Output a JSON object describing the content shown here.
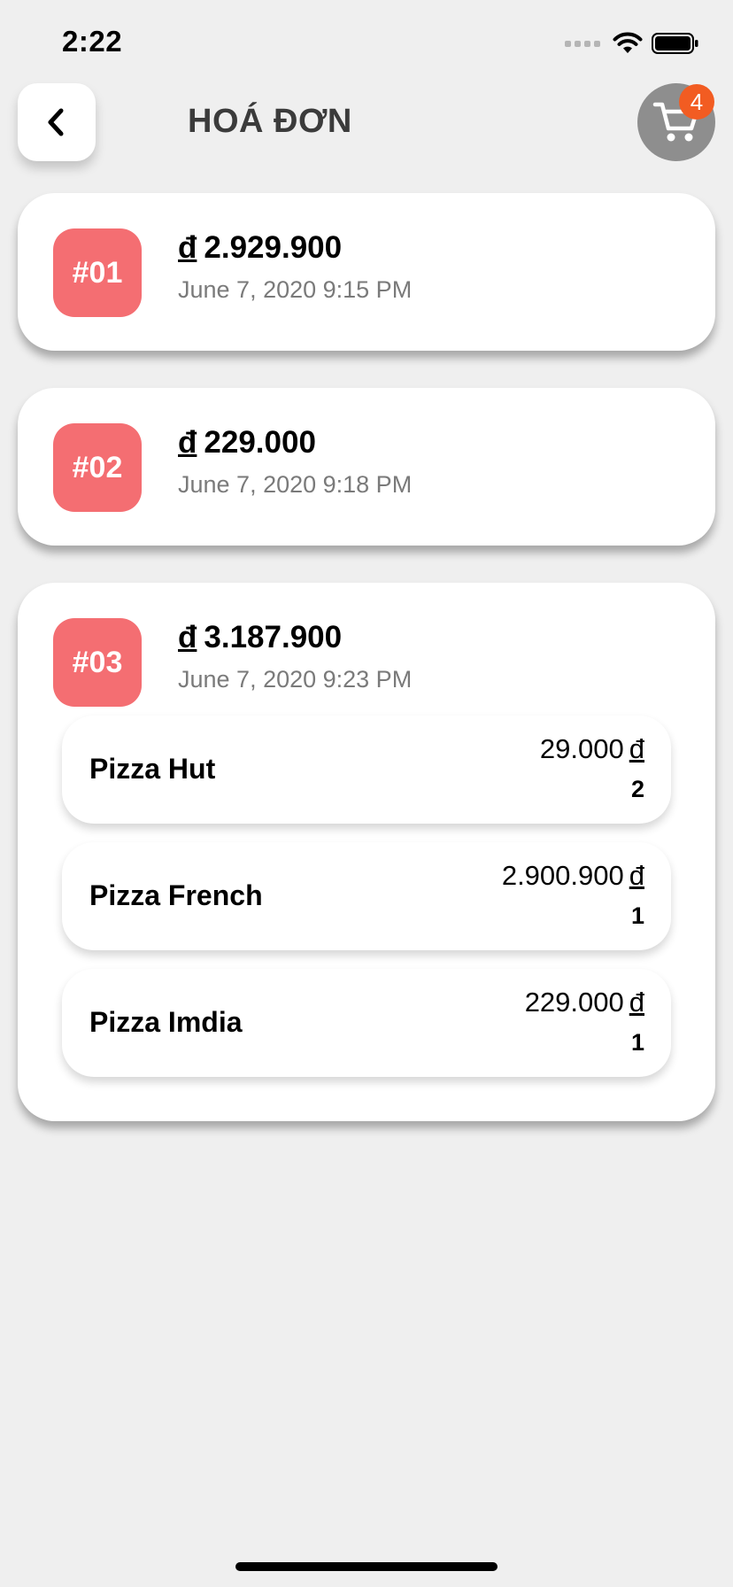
{
  "status_bar": {
    "time": "2:22"
  },
  "header": {
    "title": "HOÁ ĐƠN",
    "back_icon": "chevron-left-icon",
    "cart_icon": "cart-icon",
    "cart_count": "4"
  },
  "colors": {
    "background": "#efefef",
    "order_badge": "#f46e72",
    "cart_button": "#8e8e8e",
    "cart_badge": "#f25c22",
    "date_text": "#7a7a7a"
  },
  "currency_symbol": "đ",
  "orders": [
    {
      "id": "#01",
      "total": "2.929.900",
      "date": "June 7, 2020 9:15 PM"
    },
    {
      "id": "#02",
      "total": "229.000",
      "date": "June 7, 2020 9:18 PM"
    },
    {
      "id": "#03",
      "total": "3.187.900",
      "date": "June 7, 2020 9:23 PM",
      "items": [
        {
          "name": "Pizza Hut",
          "price": "29.000",
          "quantity": "2"
        },
        {
          "name": "Pizza French",
          "price": "2.900.900",
          "quantity": "1"
        },
        {
          "name": "Pizza Imdia",
          "price": "229.000",
          "quantity": "1"
        }
      ]
    }
  ]
}
